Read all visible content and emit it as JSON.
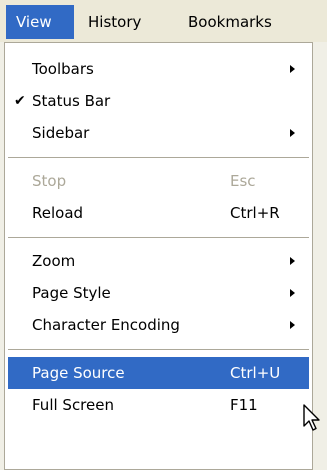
{
  "menubar": {
    "items": [
      {
        "label": "View"
      },
      {
        "label": "History"
      },
      {
        "label": "Bookmarks"
      }
    ]
  },
  "view_menu": {
    "items": [
      {
        "label": "Toolbars",
        "checked": false
      },
      {
        "label": "Status Bar",
        "checked": true
      },
      {
        "label": "Sidebar",
        "checked": false
      },
      {
        "label": "Stop",
        "shortcut": "Esc",
        "disabled": true
      },
      {
        "label": "Reload",
        "shortcut": "Ctrl+R"
      },
      {
        "label": "Zoom"
      },
      {
        "label": "Page Style"
      },
      {
        "label": "Character Encoding"
      },
      {
        "label": "Page Source",
        "shortcut": "Ctrl+U",
        "highlighted": true
      },
      {
        "label": "Full Screen",
        "shortcut": "F11"
      }
    ],
    "check_glyph": "✔"
  },
  "colors": {
    "menubar_bg": "#ece9d8",
    "highlight": "#316ac5",
    "menu_bg": "#ffffff",
    "disabled_text": "#aca899"
  }
}
